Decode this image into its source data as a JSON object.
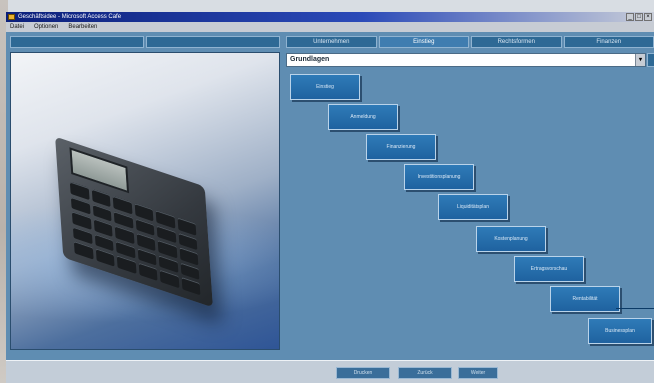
{
  "window": {
    "title": "Geschäftsidee - Microsoft Access Cafe",
    "controls": [
      "_",
      "□",
      "×"
    ]
  },
  "menu": [
    "Datei",
    "Optionen",
    "Bearbeiten"
  ],
  "left_tabs": [
    "",
    ""
  ],
  "right_tabs": [
    "Unternehmen",
    "Einstieg",
    "Rechtsformen",
    "Finanzen"
  ],
  "selector": {
    "value": "Grundlagen"
  },
  "steps": [
    "Einstieg",
    "Anmeldung",
    "Finanzierung",
    "Investitionsplanung",
    "Liquiditätsplan",
    "Kostenplanung",
    "Ertragsvorschau",
    "Rentabilität",
    "Businessplan"
  ],
  "status_buttons": [
    "Drucken",
    "Zurück",
    "Weiter"
  ],
  "colors": {
    "workspace": "#5f8db2",
    "step": "#2f7bb8",
    "title_bar": "#0b1f7a"
  }
}
